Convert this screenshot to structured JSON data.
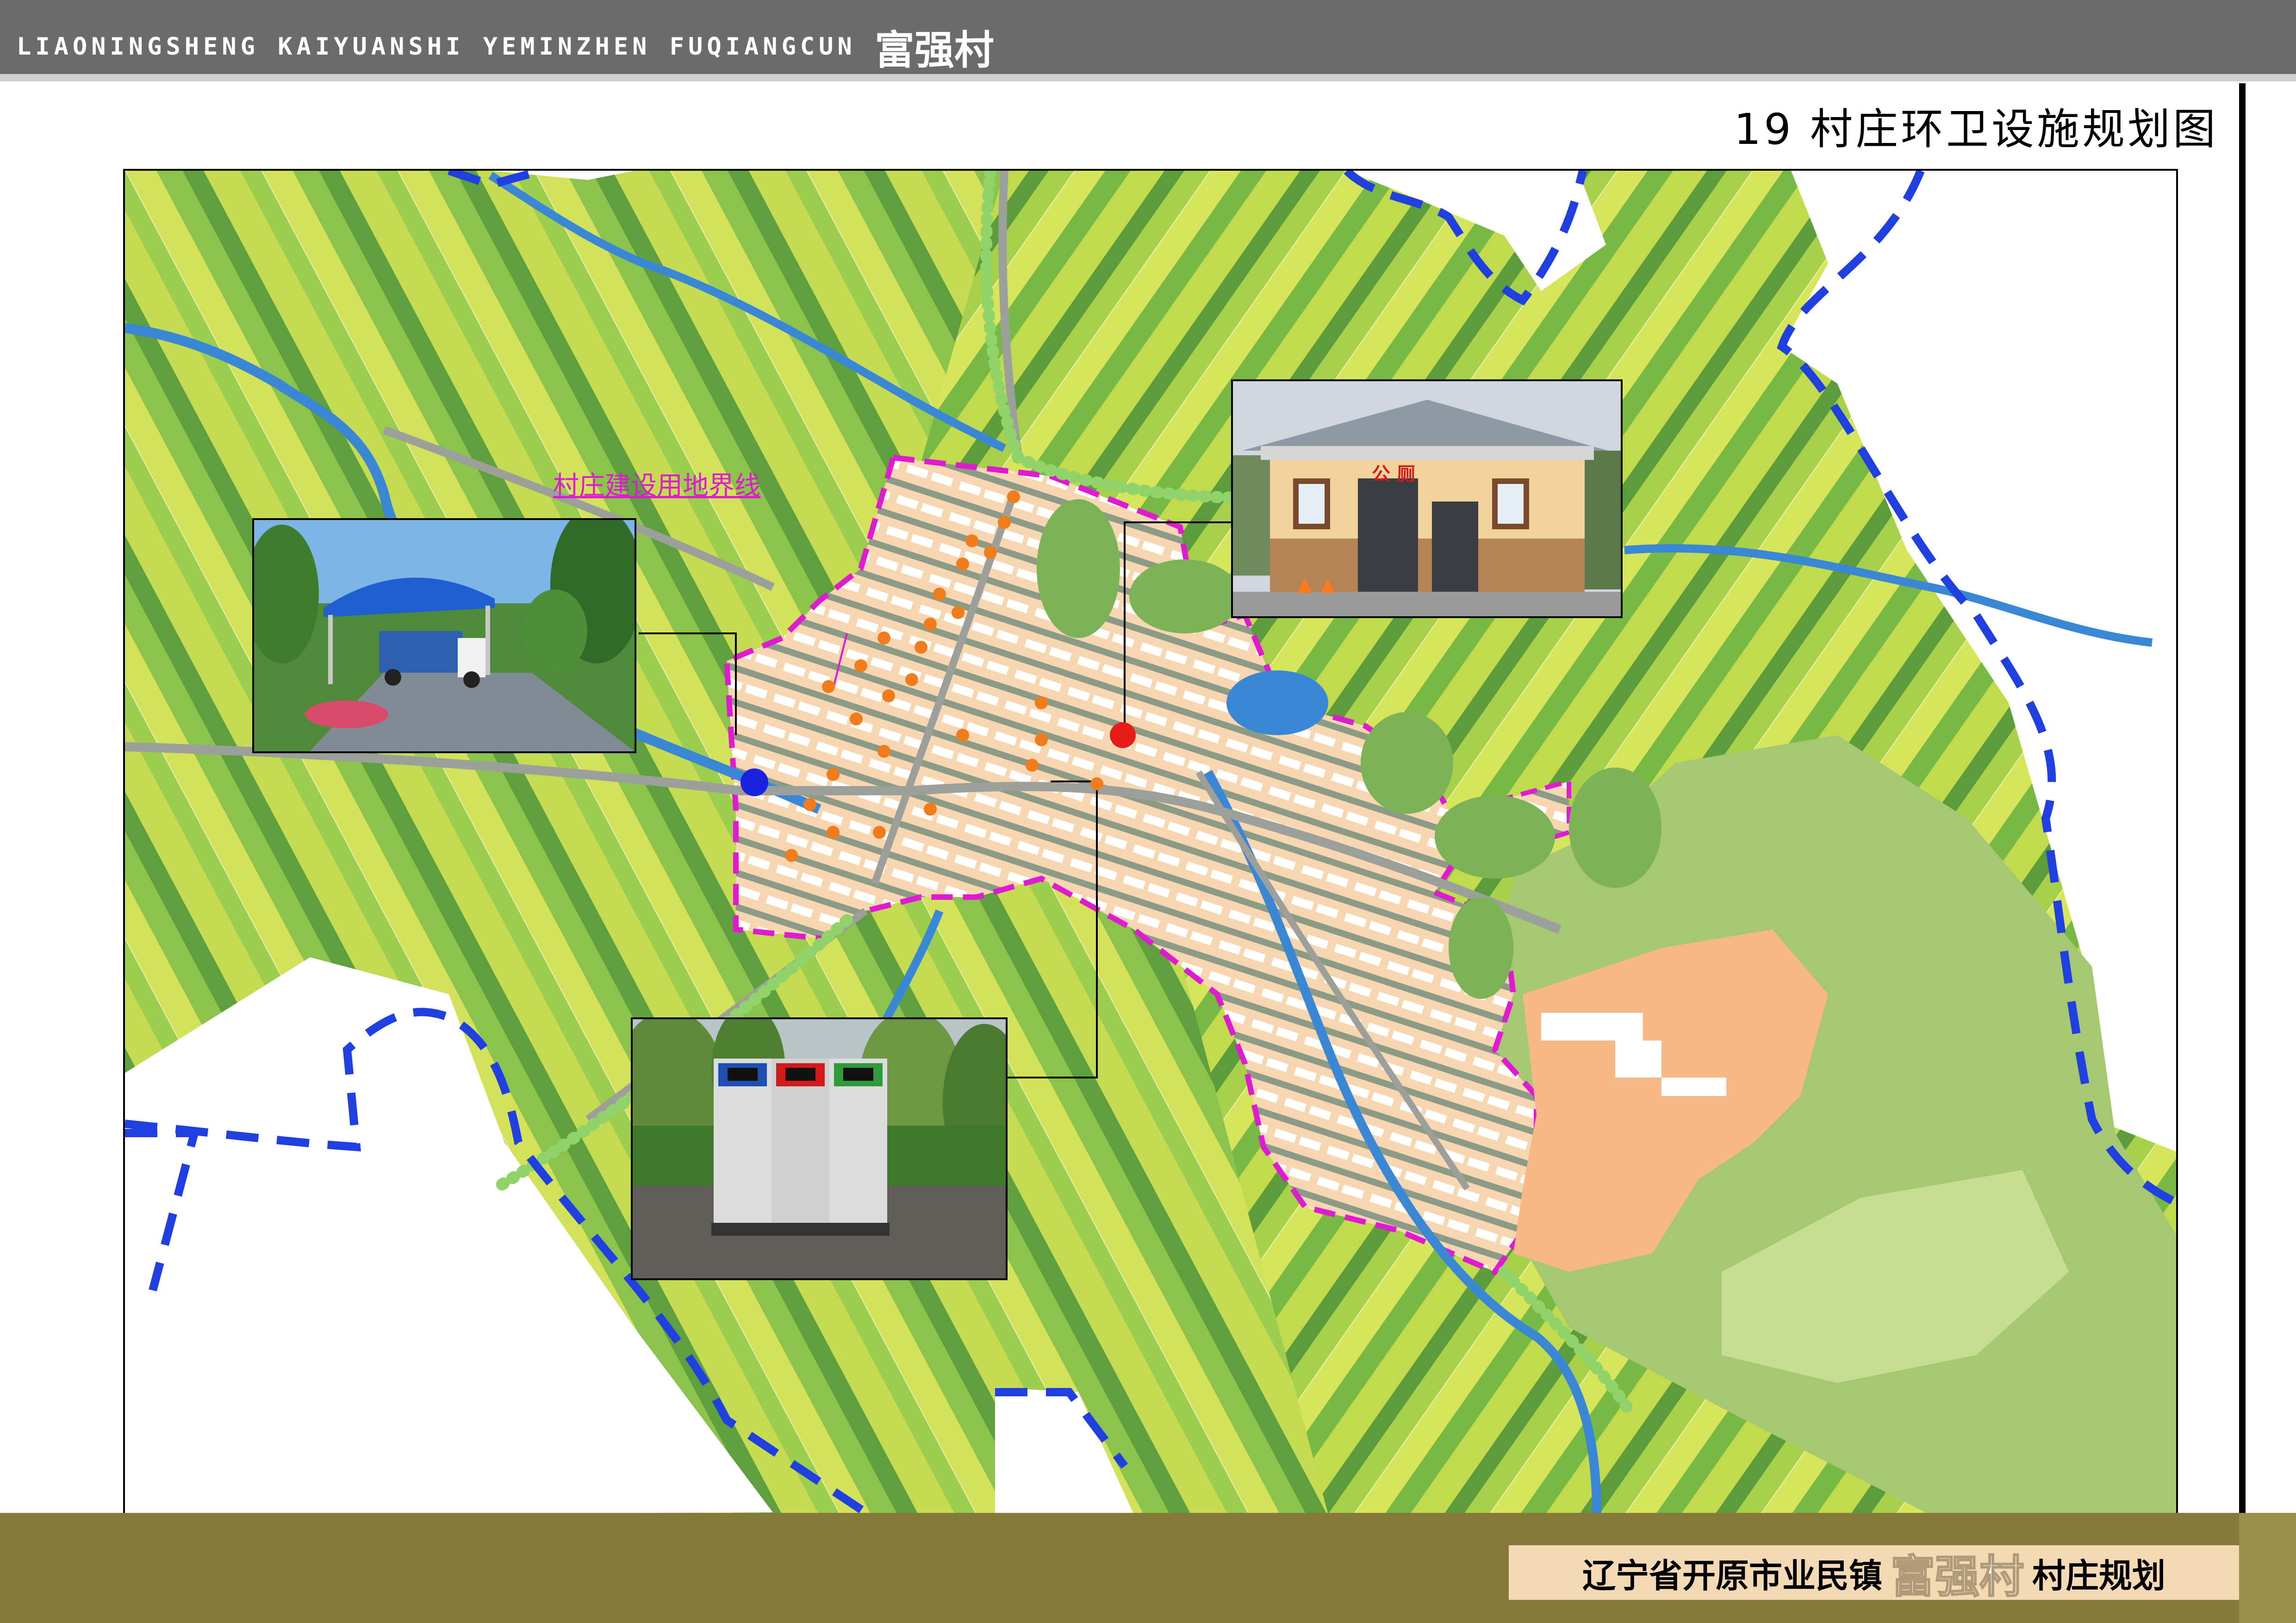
{
  "header": {
    "pinyin": "LIAONINGSHENG KAIYUANSHI YEMINZHEN FUQIANGCUN",
    "village_cn": "富强村"
  },
  "sheet": {
    "number": "19",
    "title": "村庄环卫设施规划图"
  },
  "map": {
    "boundary_label": "村庄建设用地界线",
    "toilet_sign": "公 厕",
    "colors": {
      "field_light": "#c9dc4a",
      "field_mid": "#8fc74a",
      "field_dark": "#5d9e3a",
      "river": "#3a87d6",
      "boundary": "#e01ad0",
      "town_boundary": "#1f3fe0",
      "settlement": "#f6d7b1",
      "forest": "#a3c66d",
      "trash_bin_marker": "#f07c1b",
      "toilet_marker": "#e81a1a",
      "transfer_station_marker": "#1a22e0"
    }
  },
  "footer": {
    "prefix": "辽宁省开原市业民镇",
    "village": "富强村",
    "suffix": "村庄规划"
  }
}
